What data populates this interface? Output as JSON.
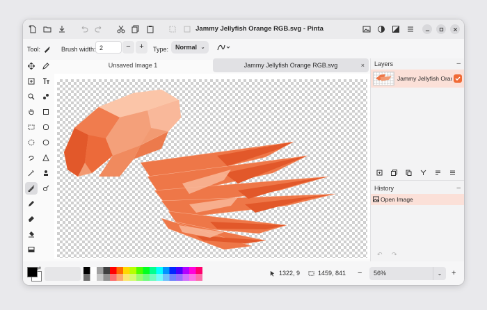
{
  "window": {
    "title": "Jammy Jellyfish Orange RGB.svg - Pinta"
  },
  "toolbar": {
    "tool_label": "Tool:",
    "brush_width_label": "Brush width:",
    "brush_width_value": "2",
    "minus": "−",
    "plus": "+",
    "type_label": "Type:",
    "blend_mode": "Normal"
  },
  "tabs": [
    {
      "label": "Unsaved Image 1"
    },
    {
      "label": "Jammy Jellyfish Orange RGB.svg",
      "close": "×"
    }
  ],
  "layers": {
    "title": "Layers",
    "collapse": "–",
    "items": [
      {
        "name": "Jammy Jellyfish Orange R",
        "visible": true
      }
    ]
  },
  "history": {
    "title": "History",
    "collapse": "–",
    "items": [
      {
        "label": "Open Image"
      }
    ]
  },
  "status": {
    "cursor_position": "1322, 9",
    "selection_size": "1459, 841",
    "zoom_minus": "−",
    "zoom_value": "56%",
    "zoom_plus": "+"
  },
  "colors": {
    "accent": "#f06a35",
    "jelly_dark": "#e2582a",
    "jelly_light": "#f9b89a",
    "palette": [
      "#000000",
      "#ffffff",
      "#a0a0a0",
      "#404040",
      "#ff0000",
      "#ff6a00",
      "#ffd800",
      "#b6ff00",
      "#4cff00",
      "#00ff21",
      "#00ff90",
      "#00ffff",
      "#0094ff",
      "#0026ff",
      "#4800ff",
      "#b200ff",
      "#ff00dc",
      "#ff006e"
    ]
  }
}
